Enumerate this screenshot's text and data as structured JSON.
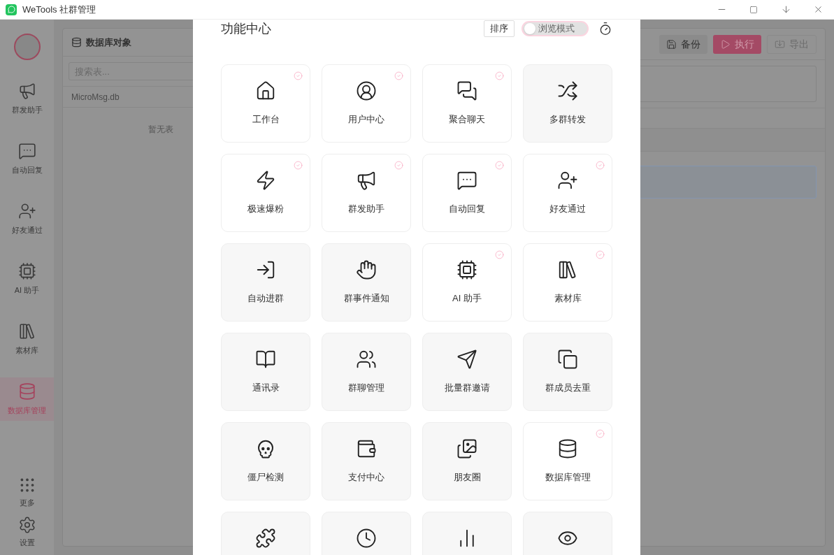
{
  "window": {
    "title": "WeTools 社群管理"
  },
  "sidebar": {
    "items": [
      {
        "label": "群发助手",
        "selected": false
      },
      {
        "label": "自动回复",
        "selected": false
      },
      {
        "label": "好友通过",
        "selected": false
      },
      {
        "label": "AI 助手",
        "selected": false
      },
      {
        "label": "素材库",
        "selected": false
      },
      {
        "label": "数据库管理",
        "selected": true
      }
    ],
    "bottom_items": [
      {
        "label": "更多"
      },
      {
        "label": "设置"
      }
    ]
  },
  "db_panel": {
    "title": "数据库对象",
    "search": {
      "placeholder": "搜索表..."
    },
    "files": [
      "MicroMsg.db"
    ],
    "empty_text": "暂无表"
  },
  "toolbar": {
    "buttons": [
      {
        "label": "备份",
        "kind": "plain",
        "disabled": false
      },
      {
        "label": "执行",
        "kind": "primary",
        "disabled": false
      },
      {
        "label": "导出",
        "kind": "plain",
        "disabled": true
      }
    ]
  },
  "dialog": {
    "title": "功能中心",
    "sort_button": "排序",
    "browse_toggle": {
      "label": "浏览模式",
      "on": false
    },
    "cards": [
      {
        "label": "工作台",
        "pinned": true
      },
      {
        "label": "用户中心",
        "pinned": true
      },
      {
        "label": "聚合聊天",
        "pinned": true
      },
      {
        "label": "多群转发",
        "pinned": false
      },
      {
        "label": "极速爆粉",
        "pinned": true
      },
      {
        "label": "群发助手",
        "pinned": true
      },
      {
        "label": "自动回复",
        "pinned": true
      },
      {
        "label": "好友通过",
        "pinned": true
      },
      {
        "label": "自动进群",
        "pinned": false
      },
      {
        "label": "群事件通知",
        "pinned": false
      },
      {
        "label": "AI 助手",
        "pinned": true
      },
      {
        "label": "素材库",
        "pinned": true
      },
      {
        "label": "通讯录",
        "pinned": false
      },
      {
        "label": "群聊管理",
        "pinned": false
      },
      {
        "label": "批量群邀请",
        "pinned": false
      },
      {
        "label": "群成员去重",
        "pinned": false
      },
      {
        "label": "僵尸检测",
        "pinned": false
      },
      {
        "label": "支付中心",
        "pinned": false
      },
      {
        "label": "朋友圈",
        "pinned": false
      },
      {
        "label": "数据库管理",
        "pinned": true
      },
      {
        "pinned": false
      },
      {
        "pinned": false
      },
      {
        "pinned": false
      },
      {
        "pinned": false
      }
    ]
  }
}
